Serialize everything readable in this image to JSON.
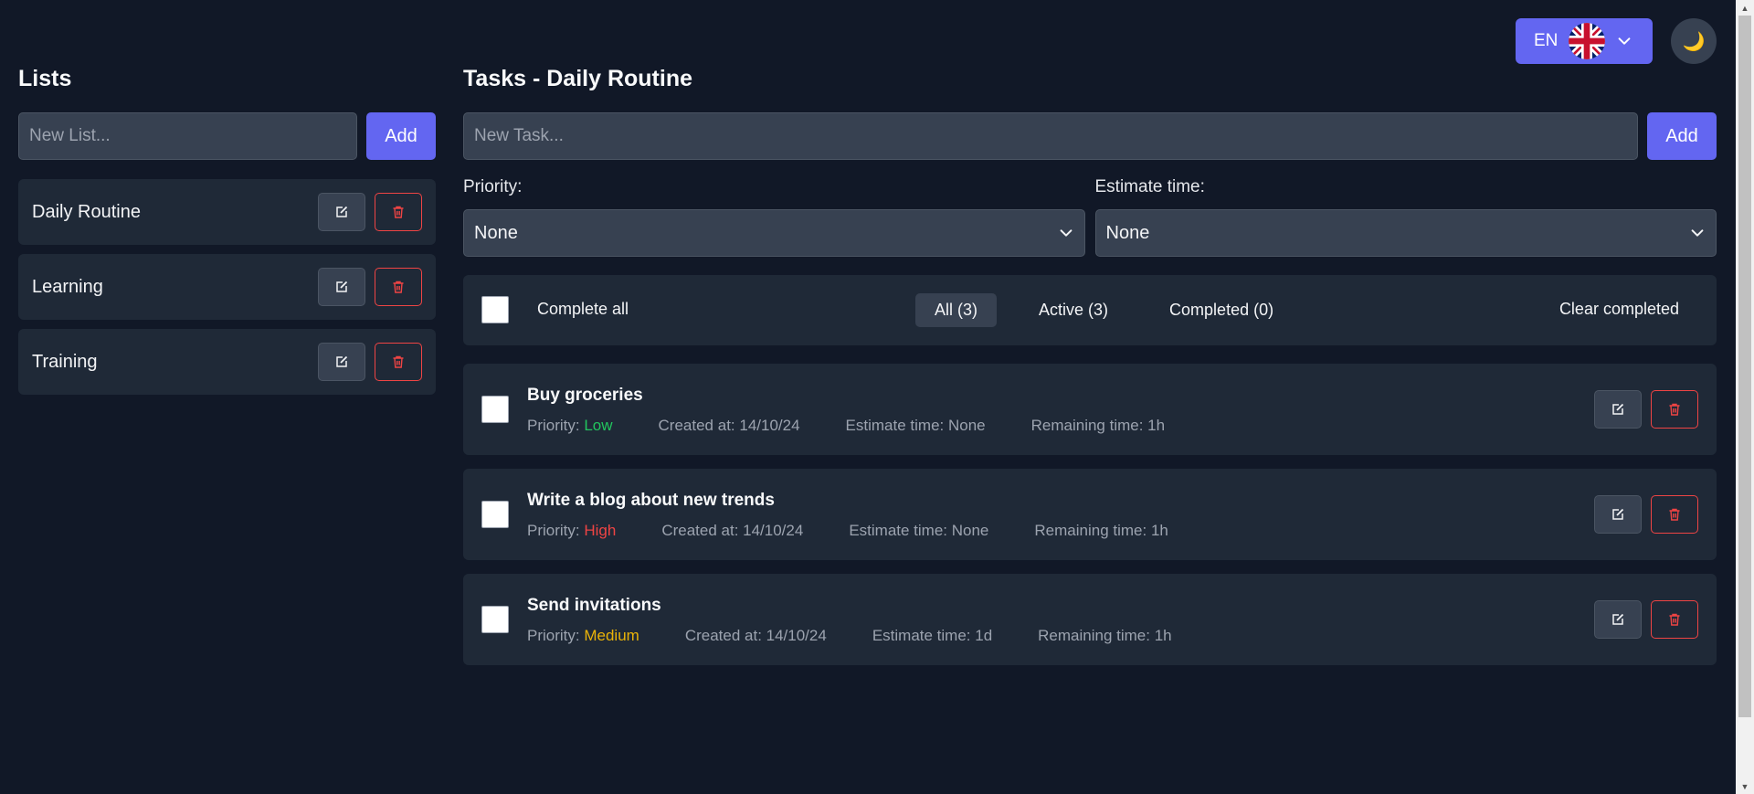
{
  "header": {
    "language": "EN",
    "flag_icon": "uk-flag-icon",
    "theme_icon": "🌙"
  },
  "lists": {
    "title": "Lists",
    "input_placeholder": "New List...",
    "add_label": "Add",
    "items": [
      {
        "name": "Daily Routine"
      },
      {
        "name": "Learning"
      },
      {
        "name": "Training"
      }
    ]
  },
  "tasks": {
    "title": "Tasks - Daily Routine",
    "input_placeholder": "New Task...",
    "add_label": "Add",
    "priority_label": "Priority:",
    "priority_value": "None",
    "estimate_label": "Estimate time:",
    "estimate_value": "None",
    "complete_all_label": "Complete all",
    "filters": [
      {
        "label": "All (3)",
        "active": true
      },
      {
        "label": "Active (3)",
        "active": false
      },
      {
        "label": "Completed (0)",
        "active": false
      }
    ],
    "clear_completed_label": "Clear completed",
    "items": [
      {
        "title": "Buy groceries",
        "priority_prefix": "Priority: ",
        "priority": "Low",
        "created": "Created at: 14/10/24",
        "estimate": "Estimate time: None",
        "remaining": "Remaining time: 1h"
      },
      {
        "title": "Write a blog about new trends",
        "priority_prefix": "Priority: ",
        "priority": "High",
        "created": "Created at: 14/10/24",
        "estimate": "Estimate time: None",
        "remaining": "Remaining time: 1h"
      },
      {
        "title": "Send invitations",
        "priority_prefix": "Priority: ",
        "priority": "Medium",
        "created": "Created at: 14/10/24",
        "estimate": "Estimate time: 1d",
        "remaining": "Remaining time: 1h"
      }
    ]
  },
  "colors": {
    "background": "#111827",
    "card": "#1f2937",
    "accent": "#6366f1",
    "priority_low": "#22c55e",
    "priority_high": "#ef4444",
    "priority_medium": "#eab308"
  }
}
